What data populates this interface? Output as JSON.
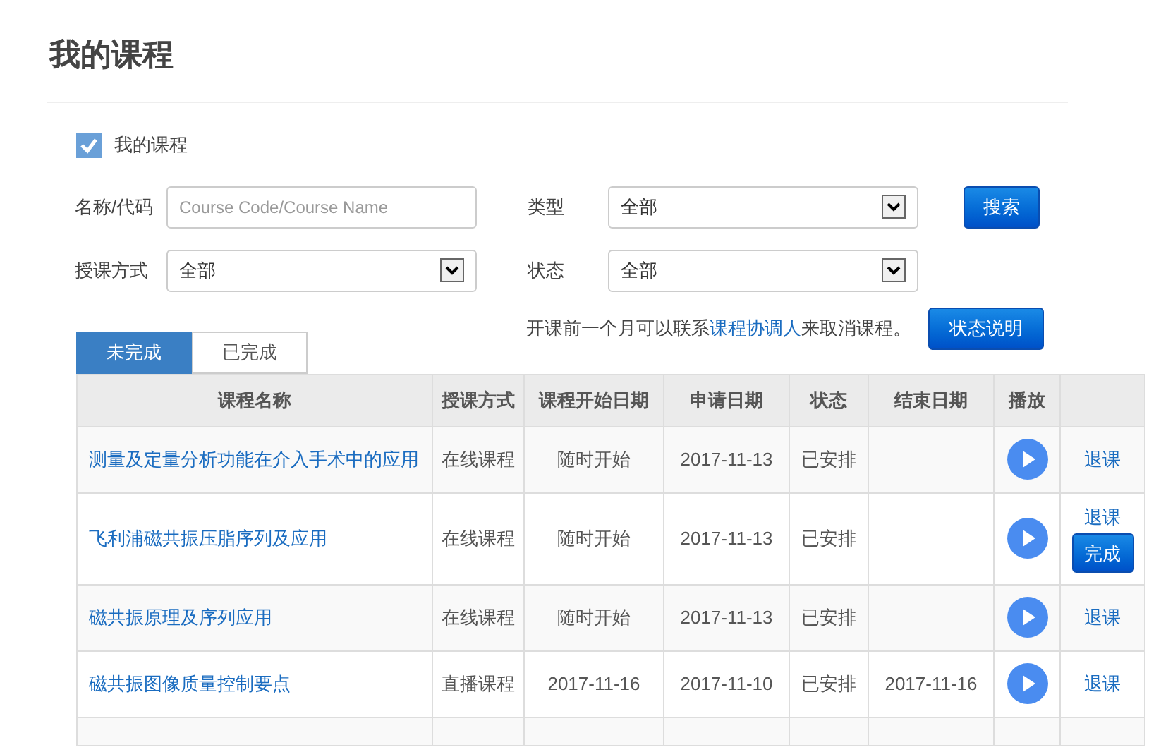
{
  "page": {
    "title": "我的课程"
  },
  "filter_checkbox": {
    "label": "我的课程",
    "checked": true
  },
  "filters": {
    "name_label": "名称/代码",
    "name_placeholder": "Course Code/Course Name",
    "type_label": "类型",
    "type_value": "全部",
    "search_button": "搜索",
    "method_label": "授课方式",
    "method_value": "全部",
    "status_label": "状态",
    "status_value": "全部"
  },
  "notice": {
    "before": "开课前一个月可以联系",
    "link": "课程协调人",
    "after": "来取消课程。"
  },
  "status_help_button": "状态说明",
  "tabs": [
    {
      "label": "未完成",
      "selected": true
    },
    {
      "label": "已完成",
      "selected": false
    }
  ],
  "table": {
    "columns": [
      "课程名称",
      "授课方式",
      "课程开始日期",
      "申请日期",
      "状态",
      "结束日期",
      "播放"
    ],
    "rows": [
      {
        "name": "测量及定量分析功能在介入手术中的应用",
        "method": "在线课程",
        "start": "随时开始",
        "applied": "2017-11-13",
        "status": "已安排",
        "actions": [
          {
            "kind": "link",
            "label": "退课"
          }
        ]
      },
      {
        "name": "飞利浦磁共振压脂序列及应用",
        "method": "在线课程",
        "start": "随时开始",
        "applied": "2017-11-13",
        "status": "已安排",
        "actions": [
          {
            "kind": "link",
            "label": "退课"
          },
          {
            "kind": "button",
            "label": "完成"
          }
        ]
      },
      {
        "name": "磁共振原理及序列应用",
        "method": "在线课程",
        "start": "随时开始",
        "applied": "2017-11-13",
        "status": "已安排",
        "actions": [
          {
            "kind": "link",
            "label": "退课"
          }
        ]
      },
      {
        "name": "磁共振图像质量控制要点",
        "method": "直播课程",
        "start": "2017-11-16",
        "applied": "2017-11-10",
        "status": "已安排",
        "end": "2017-11-16",
        "actions": [
          {
            "kind": "link",
            "label": "退课"
          }
        ]
      }
    ]
  }
}
